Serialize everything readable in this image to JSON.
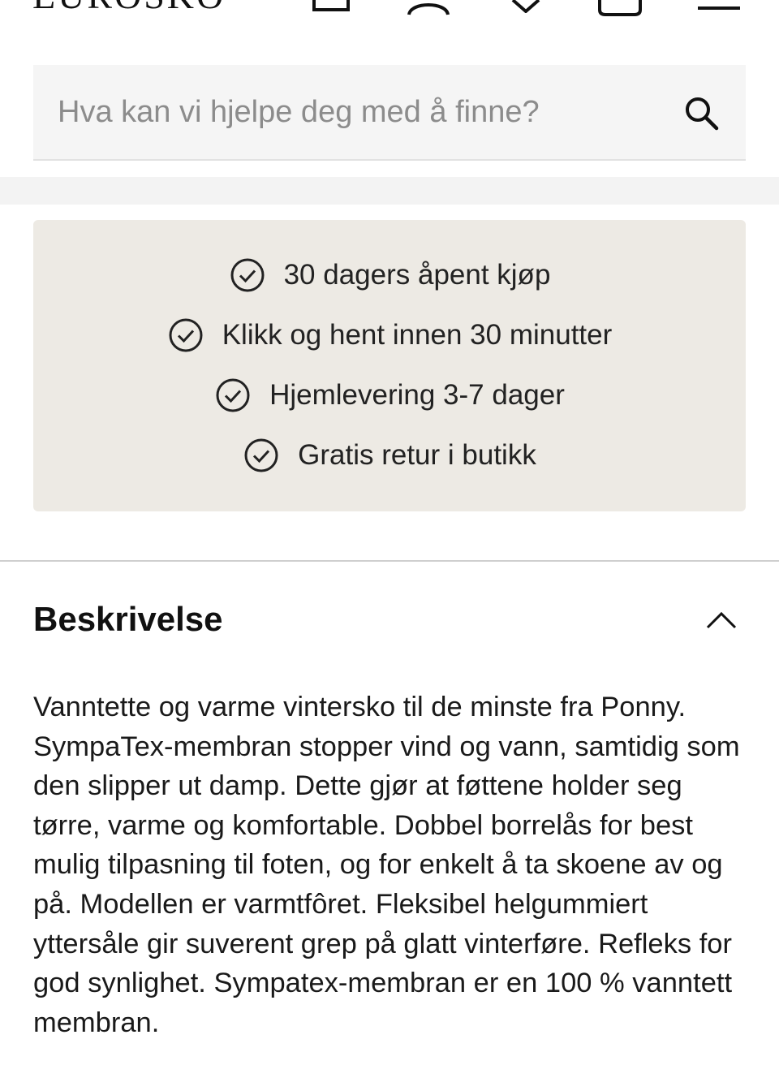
{
  "header": {
    "logo_text": "EUROSKO",
    "icons": [
      "store-icon",
      "user-icon",
      "heart-icon",
      "bag-icon",
      "menu-icon"
    ]
  },
  "search": {
    "placeholder": "Hva kan vi hjelpe deg med å finne?",
    "value": ""
  },
  "usps": [
    "30 dagers åpent kjøp",
    "Klikk og hent innen 30 minutter",
    "Hjemlevering 3-7 dager",
    "Gratis retur i butikk"
  ],
  "description": {
    "title": "Beskrivelse",
    "expanded": true,
    "text": "Vanntette og varme vintersko til de minste fra Ponny. SympaTex-membran stopper vind og vann, samtidig som den slipper ut damp. Dette gjør at føttene holder seg tørre, varme og komfortable. Dobbel borrelås for best mulig tilpasning til foten, og for enkelt å ta skoene av og på. Modellen er varmtfôret. Fleksibel helgummiert yttersåle gir suverent grep på glatt vinterføre. Refleks for god synlighet. Sympatex-membran er en 100 % vanntett membran."
  },
  "colors": {
    "usp_background": "#edeae4",
    "search_background": "#f5f5f5",
    "text": "#1a1a1a"
  }
}
